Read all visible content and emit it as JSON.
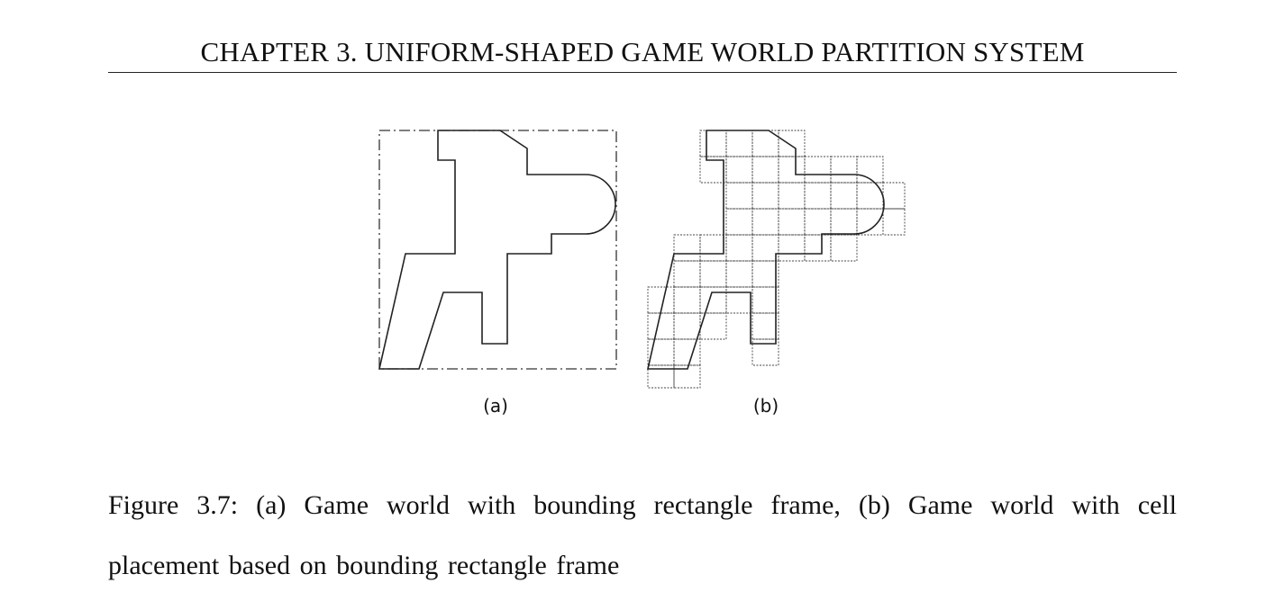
{
  "header": {
    "running_title": "CHAPTER 3.  UNIFORM-SHAPED GAME WORLD PARTITION SYSTEM"
  },
  "figure": {
    "subfigures": [
      {
        "label": "(a)"
      },
      {
        "label": "(b)"
      }
    ]
  },
  "caption": {
    "text": "Figure 3.7: (a) Game world with bounding rectangle frame, (b) Game world with cell placement based on bounding rectangle frame"
  }
}
